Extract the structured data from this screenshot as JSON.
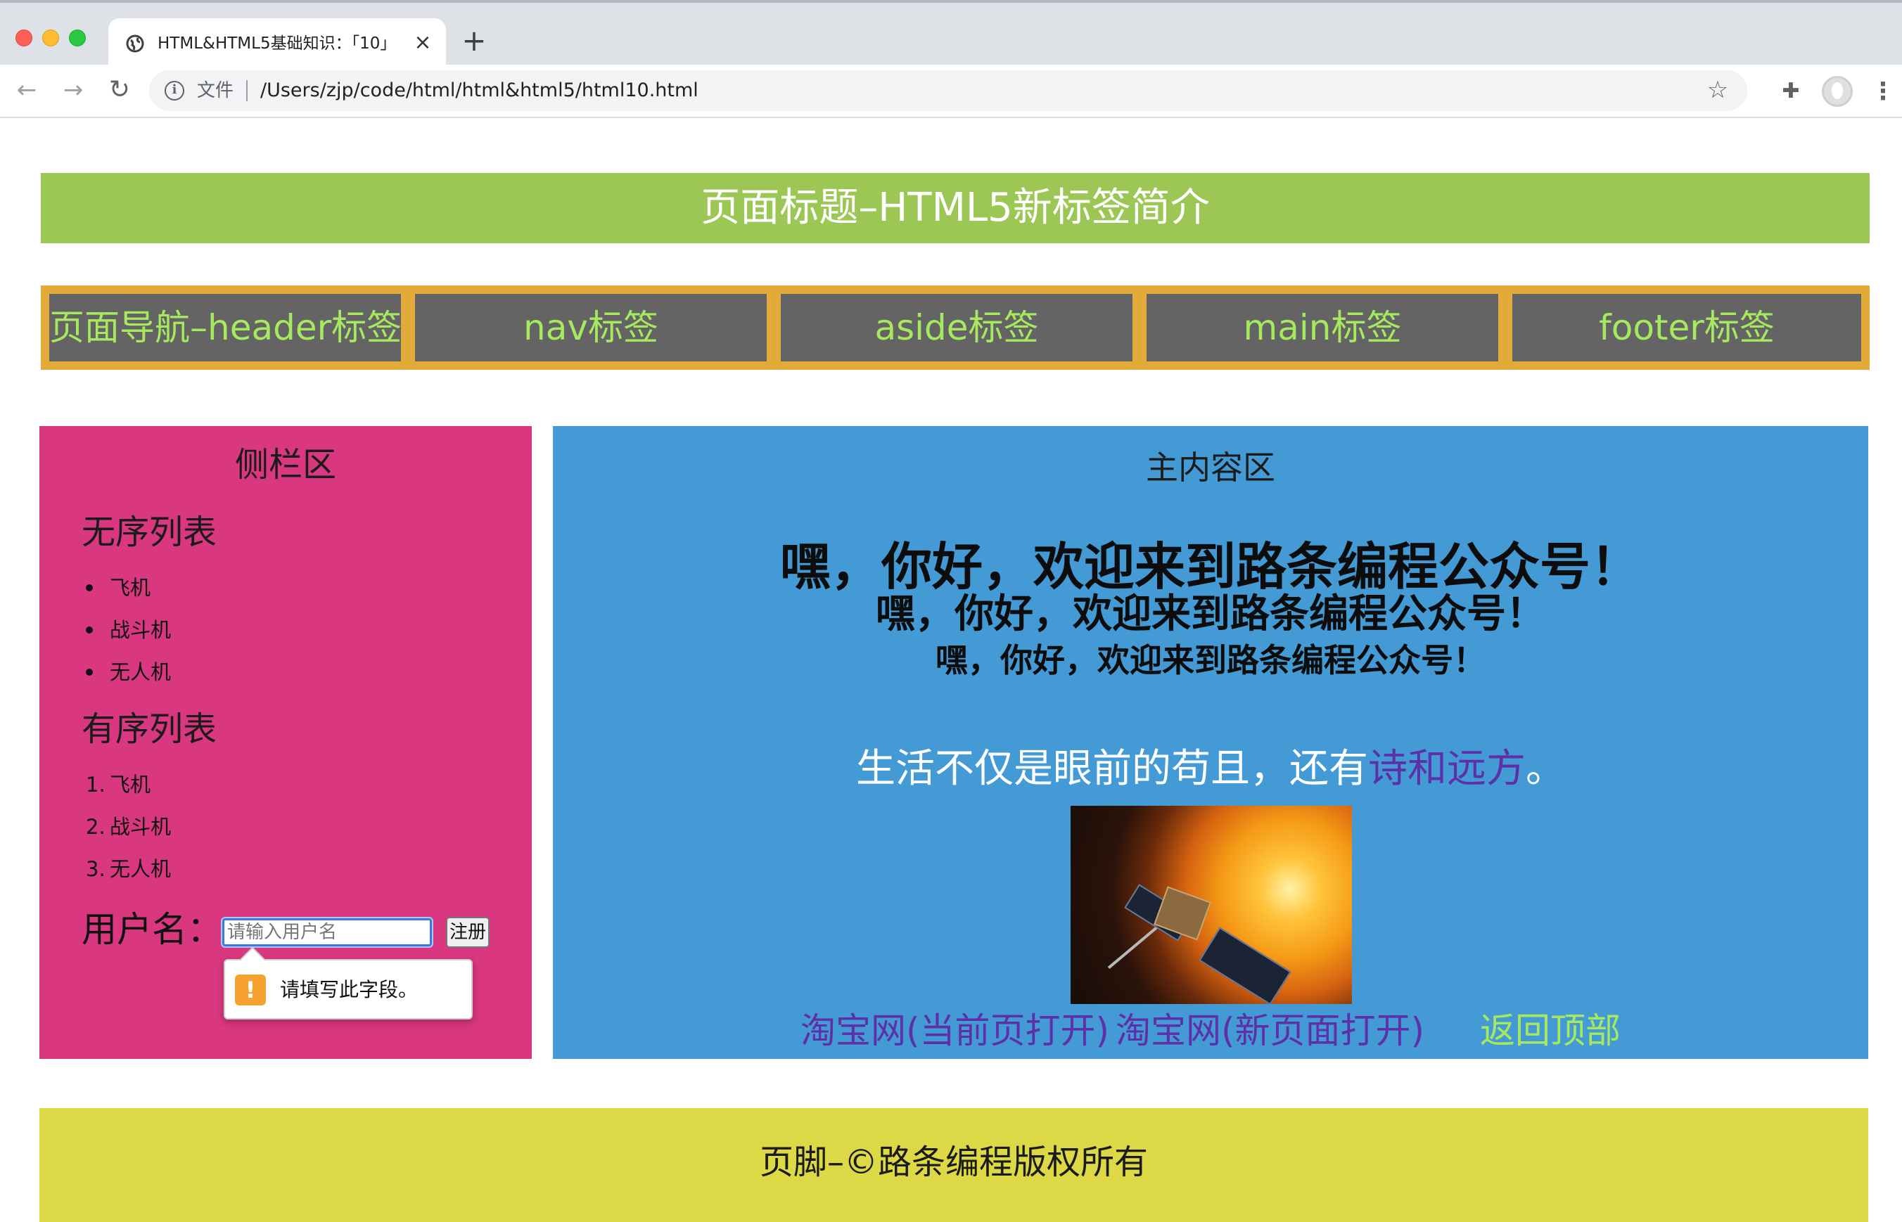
{
  "browser": {
    "tab_title": "HTML&HTML5基础知识：「10」",
    "tab_close": "×",
    "new_tab": "+",
    "back": "←",
    "forward": "→",
    "reload": "↻",
    "scheme_label": "文件",
    "url": "/Users/zjp/code/html/html&html5/html10.html",
    "star": "☆",
    "extensions": "✚",
    "menu": "⋮"
  },
  "page": {
    "title": "页面标题–HTML5新标签简介",
    "nav": [
      "页面导航–header标签",
      "nav标签",
      "aside标签",
      "main标签",
      "footer标签"
    ],
    "sidebar": {
      "title": "侧栏区",
      "unordered_heading": "无序列表",
      "unordered_items": [
        "飞机",
        "战斗机",
        "无人机"
      ],
      "ordered_heading": "有序列表",
      "ordered_items": [
        "飞机",
        "战斗机",
        "无人机"
      ],
      "ordered_numbers": [
        "1.",
        "2.",
        "3."
      ],
      "form_label": "用户名：",
      "input_value": "",
      "input_placeholder": "请输入用户名",
      "submit_label": "注册",
      "validation_message": "请填写此字段。",
      "validation_icon": "!"
    },
    "main": {
      "label": "主内容区",
      "greetings": [
        "嘿，你好，欢迎来到路条编程公众号！",
        "嘿，你好，欢迎来到路条编程公众号！",
        "嘿，你好，欢迎来到路条编程公众号！"
      ],
      "poem_prefix": "生活不仅是眼前的苟且，还有",
      "poem_link": "诗和远方",
      "poem_suffix": "。",
      "links": [
        "淘宝网(当前页打开)",
        "淘宝网(新页面打开)",
        "返回顶部"
      ]
    },
    "footer": "页脚–©路条编程版权所有"
  },
  "colors": {
    "title_bar": "#9cc754",
    "nav_border": "#e2aa38",
    "nav_cell": "#646464",
    "nav_text": "#a6e85e",
    "sidebar": "#d9377f",
    "main": "#439ad5",
    "link_visited": "#5d2fa8",
    "footer": "#dcd846"
  },
  "icons": {
    "tab": "globe-icon",
    "info": "info-icon",
    "bookmark": "star-icon",
    "extensions": "puzzle-icon",
    "profile": "avatar-icon",
    "menu": "kebab-menu-icon",
    "validation": "warning-icon"
  }
}
